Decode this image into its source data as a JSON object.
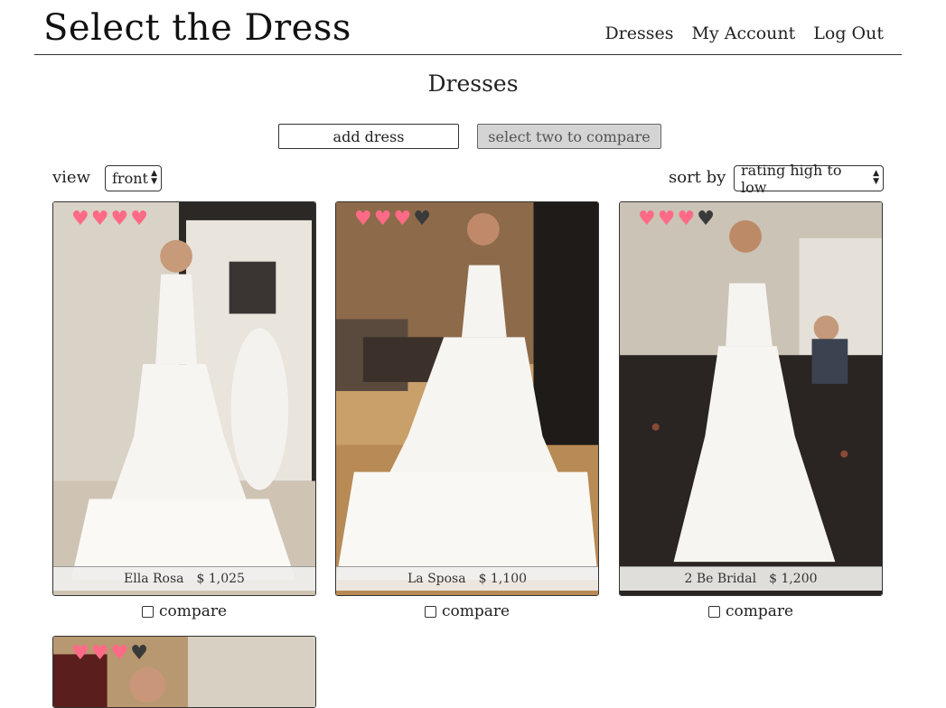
{
  "header": {
    "site_title": "Select the Dress",
    "nav": [
      "Dresses",
      "My Account",
      "Log Out"
    ]
  },
  "page_title": "Dresses",
  "actions": {
    "add_label": "add dress",
    "compare_label": "select two to compare"
  },
  "controls": {
    "view_label": "view",
    "view_value": "front",
    "sort_label": "sort by",
    "sort_value": "rating high to low"
  },
  "heart_colors": {
    "on": "#ff6b86",
    "off": "#3a3a3a"
  },
  "dresses": [
    {
      "designer": "Ella Rosa",
      "price": "$ 1,025",
      "rating": 4,
      "compare_label": "compare"
    },
    {
      "designer": "La Sposa",
      "price": "$ 1,100",
      "rating": 3,
      "compare_label": "compare"
    },
    {
      "designer": "2 Be Bridal",
      "price": "$ 1,200",
      "rating": 3,
      "compare_label": "compare"
    },
    {
      "designer": "",
      "price": "",
      "rating": 3,
      "compare_label": ""
    }
  ]
}
